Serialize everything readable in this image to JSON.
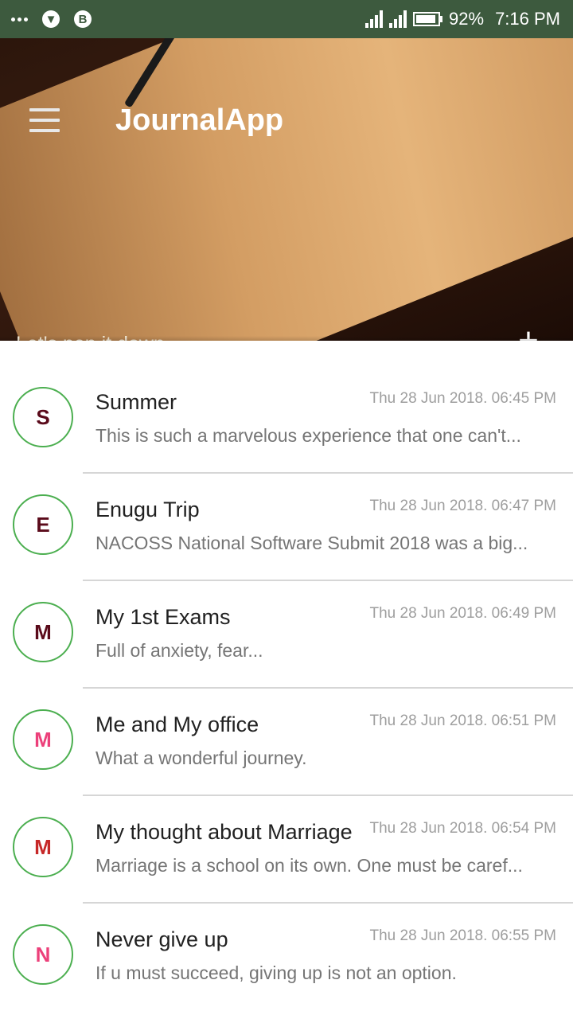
{
  "status_bar": {
    "battery": "92%",
    "time": "7:16 PM",
    "battery_fill": 0.92
  },
  "header": {
    "title": "JournalApp",
    "tagline": "Let's pen it down...",
    "add_label": "+",
    "pager_count": 3,
    "pager_active": 0
  },
  "entries": [
    {
      "initial": "S",
      "title": "Summer",
      "date": "Thu 28 Jun 2018. 06:45 PM",
      "preview": "This is such a marvelous experience that one can't...",
      "color": "#5a0a1a"
    },
    {
      "initial": "E",
      "title": "Enugu Trip",
      "date": "Thu 28 Jun 2018. 06:47 PM",
      "preview": "NACOSS National Software Submit 2018 was a big...",
      "color": "#5a0a1a"
    },
    {
      "initial": "M",
      "title": "My 1st Exams",
      "date": "Thu 28 Jun 2018. 06:49 PM",
      "preview": "Full of anxiety, fear...",
      "color": "#5a0a1a"
    },
    {
      "initial": "M",
      "title": "Me and My office",
      "date": "Thu 28 Jun 2018. 06:51 PM",
      "preview": "What a wonderful journey.",
      "color": "#ec407a"
    },
    {
      "initial": "M",
      "title": "My thought about Marriage",
      "date": "Thu 28 Jun 2018. 06:54 PM",
      "preview": "Marriage is a school on its own. One must be caref...",
      "color": "#c62828"
    },
    {
      "initial": "N",
      "title": "Never give up",
      "date": "Thu 28 Jun 2018. 06:55 PM",
      "preview": "If u must succeed, giving up is not an option.",
      "color": "#ec407a"
    }
  ]
}
